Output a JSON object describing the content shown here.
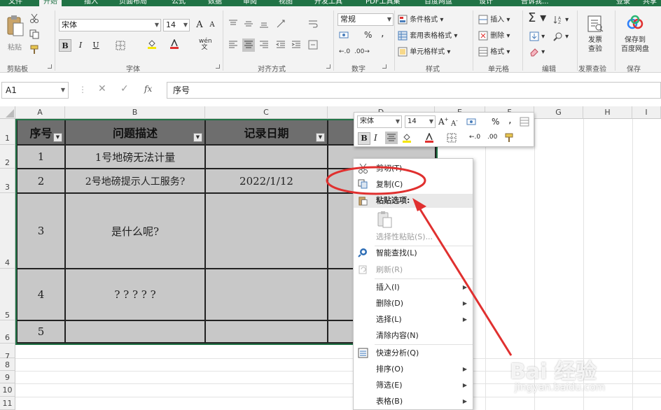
{
  "ribbon_tabs": [
    "文件",
    "开始",
    "插入",
    "页面布局",
    "公式",
    "数据",
    "审阅",
    "视图",
    "开发工具",
    "PDF工具集",
    "百度网盘",
    "设计"
  ],
  "tell_me": "告诉我...",
  "signin": "登录",
  "share": "共享",
  "clipboard": {
    "paste": "粘贴",
    "label": "剪贴板"
  },
  "font": {
    "name": "宋体",
    "size": "14",
    "bold": "B",
    "italic": "I",
    "underline": "U",
    "grow": "A",
    "shrink": "A",
    "label": "字体",
    "wen": "wén"
  },
  "alignment": {
    "label": "对齐方式"
  },
  "number": {
    "format": "常规",
    "percent": "%",
    "comma": "‚",
    "label": "数字"
  },
  "styles": {
    "conditional": "条件格式",
    "table": "套用表格格式",
    "cell": "单元格样式",
    "label": "样式"
  },
  "cells": {
    "insert": "插入",
    "delete": "删除",
    "format": "格式",
    "label": "单元格"
  },
  "editing": {
    "label": "编辑"
  },
  "invoice": {
    "line1": "发票",
    "line2": "查验",
    "label": "发票查验"
  },
  "save": {
    "line1": "保存到",
    "line2": "百度网盘",
    "label": "保存"
  },
  "namebox": "A1",
  "fx": "fx",
  "formula": "序号",
  "columns": [
    "A",
    "B",
    "C",
    "D",
    "E",
    "F",
    "G",
    "H",
    "I"
  ],
  "rows": [
    "1",
    "2",
    "3",
    "4",
    "5",
    "6",
    "7",
    "8",
    "9",
    "10",
    "11"
  ],
  "table": {
    "headers": [
      "序号",
      "问题描述",
      "记录日期"
    ],
    "rows": [
      [
        "1",
        "1号地磅无法计量",
        ""
      ],
      [
        "2",
        "2号地磅提示人工服务?",
        "2022/1/12"
      ],
      [
        "3",
        "是什么呢?",
        ""
      ],
      [
        "4",
        "? ? ? ? ?",
        ""
      ],
      [
        "5",
        "",
        ""
      ]
    ]
  },
  "minitoolbar": {
    "font": "宋体",
    "size": "14",
    "percent": "%",
    "comma": "‚"
  },
  "context_menu": {
    "items": [
      {
        "label": "剪切(T)",
        "icon": "scissors-icon"
      },
      {
        "label": "复制(C)",
        "icon": "copy-icon"
      },
      {
        "label": "粘贴选项:",
        "icon": "paste-icon"
      },
      {
        "label": "选择性粘贴(S)...",
        "icon": ""
      },
      {
        "label": "智能查找(L)",
        "icon": "search-icon"
      },
      {
        "label": "刷新(R)",
        "icon": "refresh-icon"
      },
      {
        "label": "插入(I)",
        "icon": ""
      },
      {
        "label": "删除(D)",
        "icon": ""
      },
      {
        "label": "选择(L)",
        "icon": ""
      },
      {
        "label": "清除内容(N)",
        "icon": ""
      },
      {
        "label": "快速分析(Q)",
        "icon": "quick-analysis-icon"
      },
      {
        "label": "排序(O)",
        "icon": ""
      },
      {
        "label": "筛选(E)",
        "icon": ""
      },
      {
        "label": "表格(B)",
        "icon": ""
      }
    ]
  },
  "annotation_color": "#e0302f",
  "accent": "#217346",
  "watermark": "Bai 经验",
  "watermark_sub": "jingyan.baidu.com"
}
